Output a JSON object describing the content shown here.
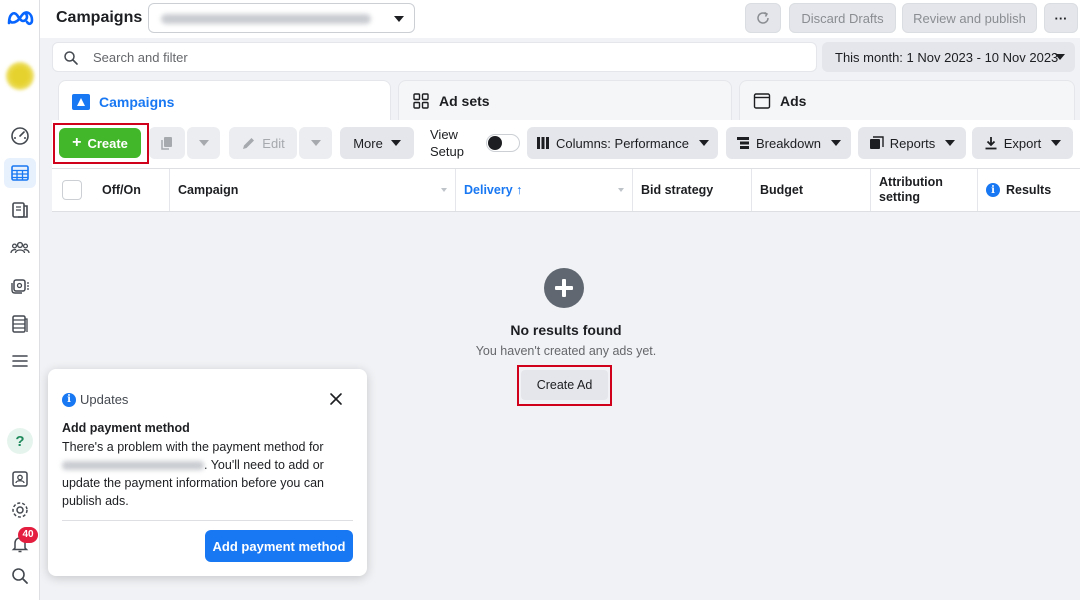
{
  "topbar": {
    "title": "Campaigns",
    "discard_label": "Discard Drafts",
    "review_label": "Review and publish",
    "more_label": "···"
  },
  "search": {
    "placeholder": "Search and filter",
    "date_range": "This month: 1 Nov 2023 - 10 Nov 2023"
  },
  "tabs": [
    {
      "label": "Campaigns",
      "active": true
    },
    {
      "label": "Ad sets",
      "active": false
    },
    {
      "label": "Ads",
      "active": false
    }
  ],
  "toolbar": {
    "create_label": "Create",
    "edit_label": "Edit",
    "more_label": "More",
    "view_setup_line1": "View",
    "view_setup_line2": "Setup",
    "columns_label": "Columns: Performance",
    "breakdown_label": "Breakdown",
    "reports_label": "Reports",
    "export_label": "Export"
  },
  "table": {
    "columns": [
      "Off/On",
      "Campaign",
      "Delivery ↑",
      "Bid strategy",
      "Budget",
      "Attribution setting",
      "Results"
    ],
    "empty_title": "No results found",
    "empty_subtitle": "You haven't created any ads yet.",
    "create_ad_label": "Create Ad"
  },
  "updates_card": {
    "header": "Updates",
    "title": "Add payment method",
    "body_part1": "There's a problem with the payment method for",
    "body_part2": ". You'll need to add or update the payment information before you can publish ads.",
    "button_label": "Add payment method"
  },
  "rail": {
    "notification_count": "40"
  },
  "colors": {
    "brand_blue": "#1877f2",
    "create_green": "#42b72a",
    "highlight_red": "#d0021b",
    "badge_red": "#e41e3f"
  }
}
